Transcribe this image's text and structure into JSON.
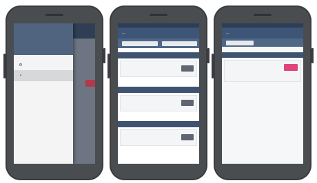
{
  "phones": [
    {
      "drawer": {
        "header_lines": [
          "",
          ""
        ],
        "items": [
          {
            "icon": "settings-icon",
            "glyph": "⚙",
            "label": ""
          },
          {
            "icon": "list-icon",
            "glyph": "▪",
            "label": ""
          }
        ]
      }
    },
    {
      "appbar": {
        "back_glyph": "←",
        "title": ""
      },
      "filter": {
        "from_label": "",
        "from_value": "",
        "to_label": "",
        "to_value": ""
      },
      "sections": [
        {
          "title": "",
          "card": {
            "lines": [
              "",
              "",
              ""
            ],
            "action_label": ""
          }
        },
        {
          "title": "",
          "card": {
            "lines": [
              "",
              "",
              ""
            ],
            "action_label": ""
          }
        },
        {
          "title": "",
          "card": {
            "lines": [
              "",
              "",
              ""
            ],
            "action_label": ""
          }
        }
      ]
    },
    {
      "appbar": {
        "back_glyph": "←",
        "title": ""
      },
      "filter": {
        "date_label": "",
        "date_value": "",
        "count": ""
      },
      "section": {
        "title": "",
        "card": {
          "lines": [
            "",
            "",
            "",
            "",
            ""
          ],
          "action_label": ""
        }
      }
    }
  ],
  "colors": {
    "appbar": "#3d5577",
    "section_header": "#3f5371",
    "action_pink": "#e0457a",
    "action_gray": "#5f6670"
  }
}
